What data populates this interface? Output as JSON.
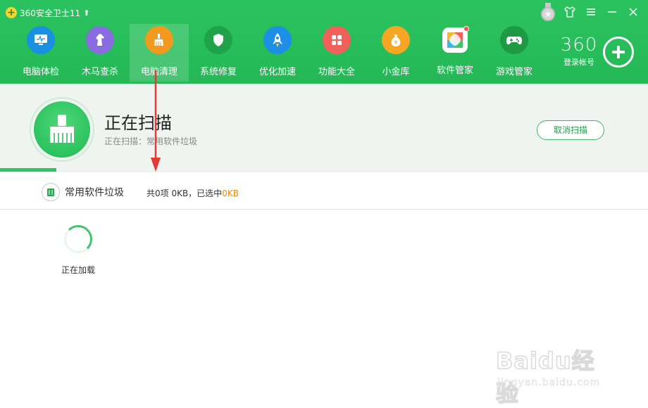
{
  "app": {
    "title": "360安全卫士11",
    "logo_icon": "360-logo-icon",
    "update_icon": "up-arrow-icon"
  },
  "window_controls": [
    "medal-icon",
    "skin-shirt-icon",
    "menu-icon",
    "minimize-icon",
    "close-icon"
  ],
  "nav": [
    {
      "label": "电脑体检",
      "icon": "monitor-check-icon",
      "color": "#1a8fe0",
      "active": false
    },
    {
      "label": "木马查杀",
      "icon": "horse-icon",
      "color": "#8a6be0",
      "active": false
    },
    {
      "label": "电脑清理",
      "icon": "broom-icon",
      "color": "#f29a1d",
      "active": true
    },
    {
      "label": "系统修复",
      "icon": "shield-icon",
      "color": "#1fa24a",
      "active": false
    },
    {
      "label": "优化加速",
      "icon": "rocket-icon",
      "color": "#1d8fe6",
      "active": false
    },
    {
      "label": "功能大全",
      "icon": "grid-apps-icon",
      "color": "#f2605a",
      "active": false
    },
    {
      "label": "小金库",
      "icon": "money-bag-icon",
      "color": "#f5a623",
      "active": false
    },
    {
      "label": "软件管家",
      "icon": "software-box-icon",
      "color": "#ffffff",
      "active": false
    },
    {
      "label": "游戏管家",
      "icon": "gamepad-icon",
      "color": "#1e9a45",
      "active": false
    }
  ],
  "account": {
    "brand": "360",
    "login_label": "登录帐号"
  },
  "scan": {
    "title": "正在扫描",
    "subtitle": "正在扫描：常用软件垃圾",
    "cancel_label": "取消扫描",
    "progress_fraction": 0.087
  },
  "category": {
    "name": "常用软件垃圾",
    "stats_prefix": "共0项 0KB，已选中",
    "stats_selected": "0KB"
  },
  "loading": {
    "text": "正在加载"
  },
  "watermark": {
    "main": "Baidu经验",
    "sub": "jingyan.baidu.com"
  },
  "colors": {
    "header_green": "#27bd59",
    "accent_orange": "#f08a14",
    "annotation_red": "#e53935"
  }
}
